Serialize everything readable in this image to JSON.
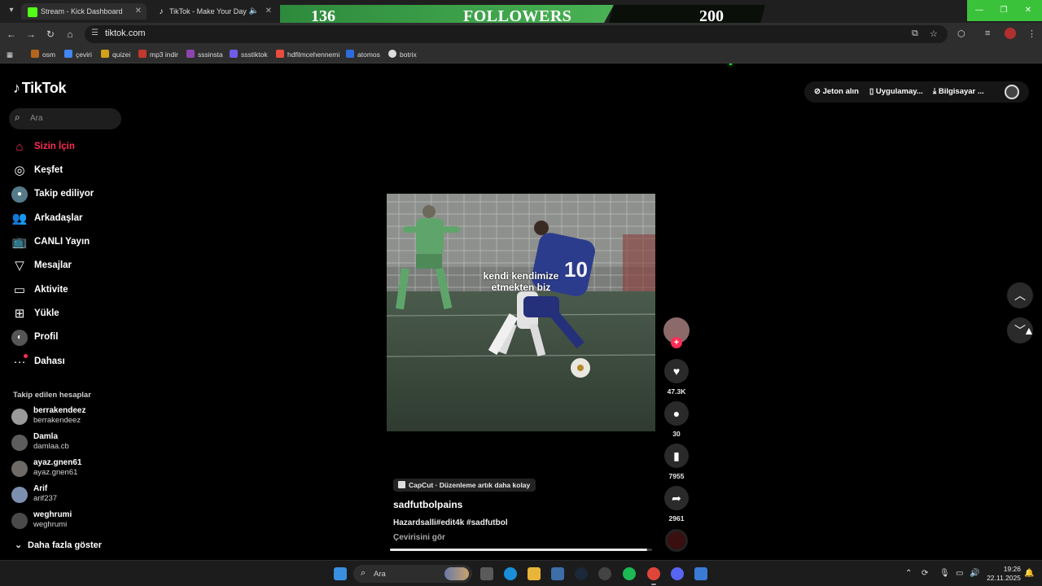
{
  "browser": {
    "tabs": [
      {
        "title": "Stream - Kick Dashboard",
        "active": true,
        "icon": "kick-icon"
      },
      {
        "title": "TikTok - Make Your Day",
        "active": false,
        "icon": "tiktok-icon"
      }
    ],
    "url": "tiktok.com",
    "bookmarks": [
      {
        "label": "osm",
        "color": "#b5651d"
      },
      {
        "label": "çeviri",
        "color": "#4285f4"
      },
      {
        "label": "quizei",
        "color": "#d4a017"
      },
      {
        "label": "mp3 indir",
        "color": "#c0392b"
      },
      {
        "label": "sssinsta",
        "color": "#8e44ad"
      },
      {
        "label": "ssstiktok",
        "color": "#6c5ce7"
      },
      {
        "label": "hdfilmcehennemi",
        "color": "#e74c3c"
      },
      {
        "label": "atomos",
        "color": "#2d6cdf"
      },
      {
        "label": "botrix",
        "color": "#dddddd"
      }
    ]
  },
  "stream_overlay": {
    "current": "136",
    "label": "FOLLOWERS",
    "goal": "200",
    "accent": "#49b254"
  },
  "tiktok": {
    "logo": "TikTok",
    "search_placeholder": "Ara",
    "nav": [
      {
        "label": "Sizin İçin",
        "icon": "home-icon",
        "active": true
      },
      {
        "label": "Keşfet",
        "icon": "compass-icon",
        "active": false
      },
      {
        "label": "Takip ediliyor",
        "icon": "following-avatar-icon",
        "active": false
      },
      {
        "label": "Arkadaşlar",
        "icon": "friends-icon",
        "active": false
      },
      {
        "label": "CANLI Yayın",
        "icon": "live-tv-icon",
        "active": false
      },
      {
        "label": "Mesajlar",
        "icon": "paper-plane-icon",
        "active": false
      },
      {
        "label": "Aktivite",
        "icon": "chat-bubble-icon",
        "active": false
      },
      {
        "label": "Yükle",
        "icon": "plus-square-icon",
        "active": false
      },
      {
        "label": "Profil",
        "icon": "profile-icon",
        "active": false
      },
      {
        "label": "Dahası",
        "icon": "more-dots-icon",
        "active": false
      }
    ],
    "following_title": "Takip edilen hesaplar",
    "following": [
      {
        "name": "berrakendeez",
        "handle": "berrakendeez"
      },
      {
        "name": "Damla",
        "handle": "damlaa.cb"
      },
      {
        "name": "ayaz.gnen61",
        "handle": "ayaz.gnen61"
      },
      {
        "name": "Arif",
        "handle": "arif237"
      },
      {
        "name": "weghrumi",
        "handle": "weghrumi"
      }
    ],
    "show_more": "Daha fazla göster",
    "top_actions": {
      "coins": "Jeton alın",
      "app": "Uygulamay...",
      "desktop": "Bilgisayar ..."
    },
    "video": {
      "caption_line1": "kendi kendimize",
      "caption_line2": "etmekten biz",
      "jersey_number": "10",
      "likes": "47.3K",
      "comments": "30",
      "saves": "7955",
      "shares": "2961",
      "badge": "CapCut · Düzenleme artık daha kolay",
      "author": "sadfutbolpains",
      "description": "Hazardsalli#edit4k #sadfutbol",
      "translate": "Çevirisini gör",
      "progress": 0.98
    }
  },
  "taskbar": {
    "search": "Ara",
    "time": "19:26",
    "date": "22.11.2025"
  }
}
